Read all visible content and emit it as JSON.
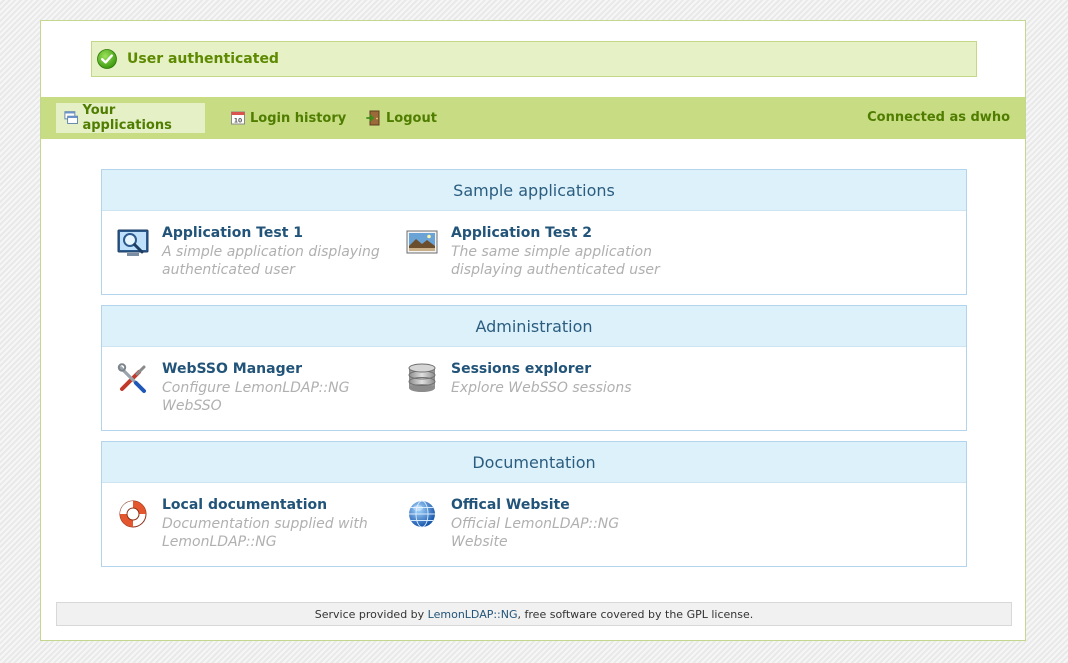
{
  "status": {
    "message": "User authenticated",
    "icon": "check-circle-icon"
  },
  "menu": {
    "items": [
      {
        "label": "Your applications",
        "icon": "applications-icon",
        "active": true
      },
      {
        "label": "Login history",
        "icon": "calendar-icon",
        "active": false
      },
      {
        "label": "Logout",
        "icon": "logout-door-icon",
        "active": false
      }
    ],
    "connected_as": "Connected as dwho"
  },
  "sections": [
    {
      "title": "Sample applications",
      "apps": [
        {
          "name": "Application Test 1",
          "description": "A simple application displaying authenticated user",
          "icon": "magnifier-screen-icon"
        },
        {
          "name": "Application Test 2",
          "description": "The same simple application displaying authenticated user",
          "icon": "landscape-picture-icon"
        }
      ]
    },
    {
      "title": "Administration",
      "apps": [
        {
          "name": "WebSSO Manager",
          "description": "Configure LemonLDAP::NG WebSSO",
          "icon": "tools-icon"
        },
        {
          "name": "Sessions explorer",
          "description": "Explore WebSSO sessions",
          "icon": "database-icon"
        }
      ]
    },
    {
      "title": "Documentation",
      "apps": [
        {
          "name": "Local documentation",
          "description": "Documentation supplied with LemonLDAP::NG",
          "icon": "lifebuoy-icon"
        },
        {
          "name": "Offical Website",
          "description": "Official LemonLDAP::NG Website",
          "icon": "globe-icon"
        }
      ]
    }
  ],
  "footer": {
    "prefix": "Service provided by ",
    "link": "LemonLDAP::NG",
    "suffix": ", free software covered by the GPL license."
  },
  "colors": {
    "accent_green": "#c8dc84",
    "text_green": "#4f7d00",
    "section_header_bg": "#ddf1fb",
    "link_blue": "#225479"
  }
}
